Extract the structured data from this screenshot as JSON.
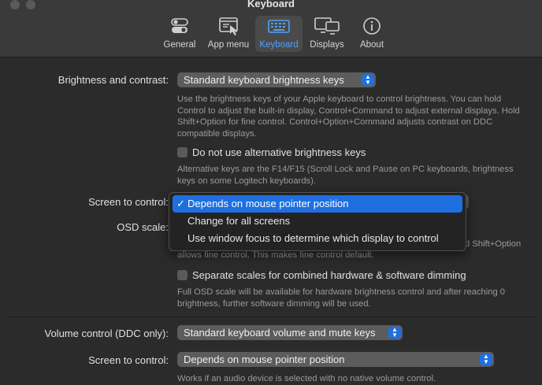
{
  "window": {
    "title": "Keyboard"
  },
  "tabs": [
    {
      "label": "General",
      "icon": "toggle-icon"
    },
    {
      "label": "App menu",
      "icon": "app-menu-icon"
    },
    {
      "label": "Keyboard",
      "icon": "keyboard-icon",
      "active": true
    },
    {
      "label": "Displays",
      "icon": "displays-icon"
    },
    {
      "label": "About",
      "icon": "info-icon"
    }
  ],
  "brightness": {
    "label": "Brightness and contrast:",
    "popup_value": "Standard keyboard brightness keys",
    "help_lines": [
      "Use the brightness keys of your Apple keyboard to control brightness. You can hold",
      "Control to adjust the built-in display, Control+Command to adjust external displays. Hold",
      "Shift+Option for fine control. Control+Option+Command adjusts contrast on DDC",
      "compatible displays."
    ],
    "alt_keys_checkbox": "Do not use alternative brightness keys",
    "alt_keys_help_lines": [
      "Alternative keys are the F14/F15 (Scroll Lock and Pause on PC keyboards, brightness",
      "keys on some Logitech keyboards)."
    ],
    "screen_label": "Screen to control:",
    "osd_label": "OSD scale:",
    "osd_help_tail_1": "d Shift+Option",
    "osd_help_line_2": "allows fine control. This makes fine control default.",
    "separate_checkbox": "Separate scales for combined hardware & software dimming",
    "separate_help_lines": [
      "Full OSD scale will be available for hardware brightness control and after reaching 0",
      "brightness, further software dimming will be used."
    ]
  },
  "screen_menu": {
    "options": [
      "Depends on mouse pointer position",
      "Change for all screens",
      "Use window focus to determine which display to control"
    ],
    "selected_index": 0,
    "check_glyph": "✓"
  },
  "volume": {
    "label": "Volume control (DDC only):",
    "popup_value": "Standard keyboard volume and mute keys",
    "screen_label": "Screen to control:",
    "screen_popup_value": "Depends on mouse pointer position",
    "help": "Works if an audio device is selected with no native volume control."
  },
  "colors": {
    "accent": "#1f6fe0",
    "active_tab_text": "#4da3ff"
  }
}
